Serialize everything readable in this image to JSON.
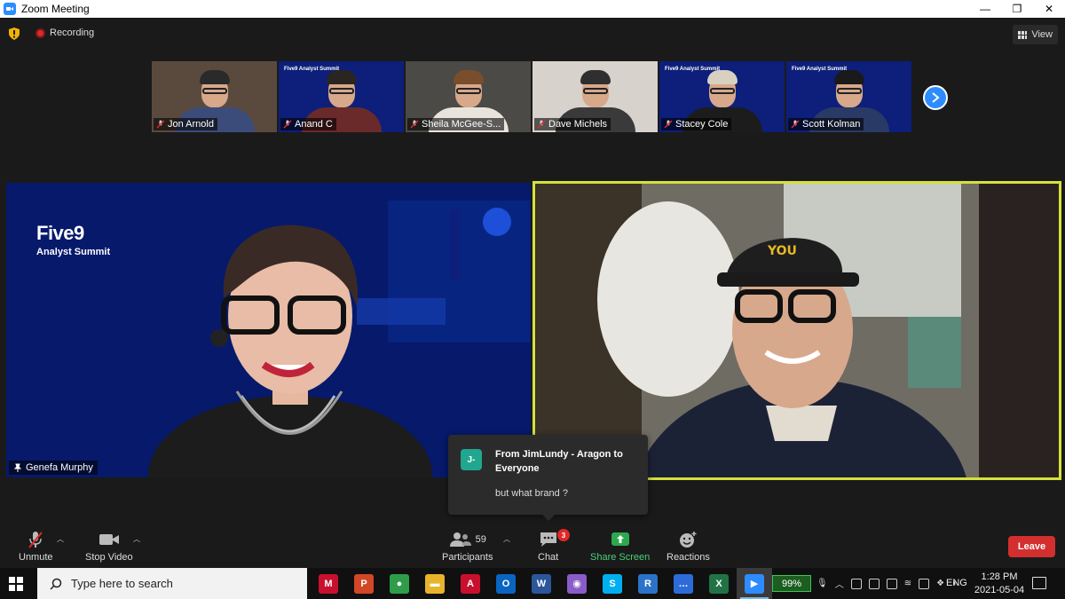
{
  "window": {
    "title": "Zoom Meeting",
    "minimize": "—",
    "restore": "❐",
    "close": "✕"
  },
  "topbar": {
    "recording_label": "Recording",
    "view_label": "View"
  },
  "thumbnails": [
    {
      "name": "Jon Arnold",
      "bg": "#5a4a3e",
      "hair": "#2a2a2a",
      "body": "#3c4c7a",
      "logo": ""
    },
    {
      "name": "Anand C",
      "bg": "#0d1f7a",
      "hair": "#2a2520",
      "body": "#6a2a2a",
      "logo": "Five9 Analyst Summit"
    },
    {
      "name": "Sheila McGee-S...",
      "bg": "#4b4a46",
      "hair": "#7a4e2c",
      "body": "#e8e4dc",
      "logo": ""
    },
    {
      "name": "Dave Michels",
      "bg": "#d8d2cc",
      "hair": "#2f2f2f",
      "body": "#3a3a3a",
      "logo": ""
    },
    {
      "name": "Stacey Cole",
      "bg": "#0d1f7a",
      "hair": "#d8d0c0",
      "body": "#1c1c1c",
      "logo": "Five9 Analyst Summit"
    },
    {
      "name": "Scott Kolman",
      "bg": "#0d1f7a",
      "hair": "#1a1a1a",
      "body": "#2a3a66",
      "logo": "Five9 Analyst Summit"
    }
  ],
  "main": {
    "left": {
      "brand": "Five9",
      "brand_sub": "Analyst Summit",
      "name": "Genefa Murphy"
    }
  },
  "chat": {
    "avatar": "J-",
    "from": "From JimLundy - Aragon to Everyone",
    "message": "but what brand ?"
  },
  "toolbar": {
    "unmute": "Unmute",
    "stop_video": "Stop Video",
    "participants": "Participants",
    "participant_count": "59",
    "chat": "Chat",
    "chat_badge": "3",
    "share_screen": "Share Screen",
    "reactions": "Reactions",
    "leave": "Leave"
  },
  "taskbar": {
    "search_placeholder": "Type here to search",
    "apps": [
      {
        "name": "mcafee",
        "label": "M",
        "color": "#c8102e"
      },
      {
        "name": "powerpoint",
        "label": "P",
        "color": "#d24726"
      },
      {
        "name": "chrome",
        "label": "●",
        "color": "#2e9d4a"
      },
      {
        "name": "file-explorer",
        "label": "▬",
        "color": "#e8b42a"
      },
      {
        "name": "acrobat",
        "label": "A",
        "color": "#c8102e"
      },
      {
        "name": "outlook",
        "label": "O",
        "color": "#0a64c2"
      },
      {
        "name": "word",
        "label": "W",
        "color": "#2b579a"
      },
      {
        "name": "photos",
        "label": "◉",
        "color": "#8a5cc8"
      },
      {
        "name": "skype",
        "label": "S",
        "color": "#00aff0"
      },
      {
        "name": "app-r",
        "label": "R",
        "color": "#2a73c8"
      },
      {
        "name": "teams-chat",
        "label": "…",
        "color": "#2d6cd8"
      },
      {
        "name": "excel",
        "label": "X",
        "color": "#217346"
      },
      {
        "name": "zoom",
        "label": "▶",
        "color": "#2d8cff"
      }
    ],
    "battery": "99%",
    "language": "ENG",
    "time": "1:28 PM",
    "date": "2021-05-04"
  }
}
